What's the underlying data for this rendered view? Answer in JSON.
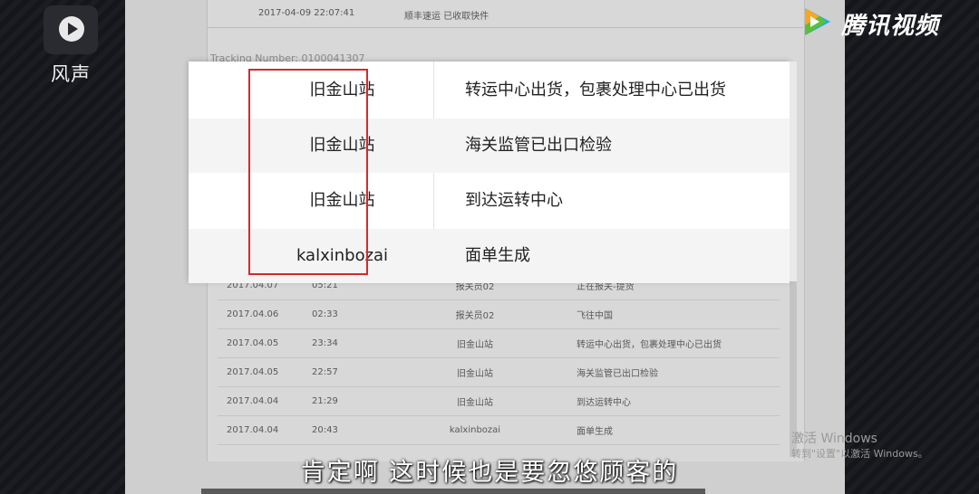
{
  "player": {
    "app_name": "风声",
    "brand": "腾讯视频",
    "subtitle": "肯定啊  这时候也是要忽悠顾客的"
  },
  "watermark": {
    "line1": "激活 Windows",
    "line2": "转到\"设置\"以激活 Windows。"
  },
  "document": {
    "top_row": {
      "datetime": "2017-04-09 22:07:41",
      "status": "顺丰速运 已收取快件"
    },
    "tracking_label": "Tracking Number: 0100041307",
    "rows": [
      {
        "date": "2017.04.07",
        "time": "05:21",
        "location": "报关员02",
        "desc": "正在报关-提货"
      },
      {
        "date": "2017.04.06",
        "time": "02:33",
        "location": "报关员02",
        "desc": "飞往中国"
      },
      {
        "date": "2017.04.05",
        "time": "23:34",
        "location": "旧金山站",
        "desc": "转运中心出货，包裹处理中心已出货"
      },
      {
        "date": "2017.04.05",
        "time": "22:57",
        "location": "旧金山站",
        "desc": "海关监管已出口检验"
      },
      {
        "date": "2017.04.04",
        "time": "21:29",
        "location": "旧金山站",
        "desc": "到达运转中心"
      },
      {
        "date": "2017.04.04",
        "time": "20:43",
        "location": "kalxinbozai",
        "desc": "面单生成"
      }
    ]
  },
  "zoom": {
    "rows": [
      {
        "location": "旧金山站",
        "desc": "转运中心出货，包裹处理中心已出货"
      },
      {
        "location": "旧金山站",
        "desc": "海关监管已出口检验"
      },
      {
        "location": "旧金山站",
        "desc": "到达运转中心"
      },
      {
        "location": "kalxinbozai",
        "desc": "面单生成"
      }
    ]
  },
  "colors": {
    "highlight_border": "#d42a2a",
    "brand_icon_blue": "#21a8f2",
    "brand_icon_orange": "#f7a823",
    "brand_icon_green": "#5ac034"
  },
  "icons": [
    "player-logo-icon",
    "tencent-video-icon"
  ]
}
